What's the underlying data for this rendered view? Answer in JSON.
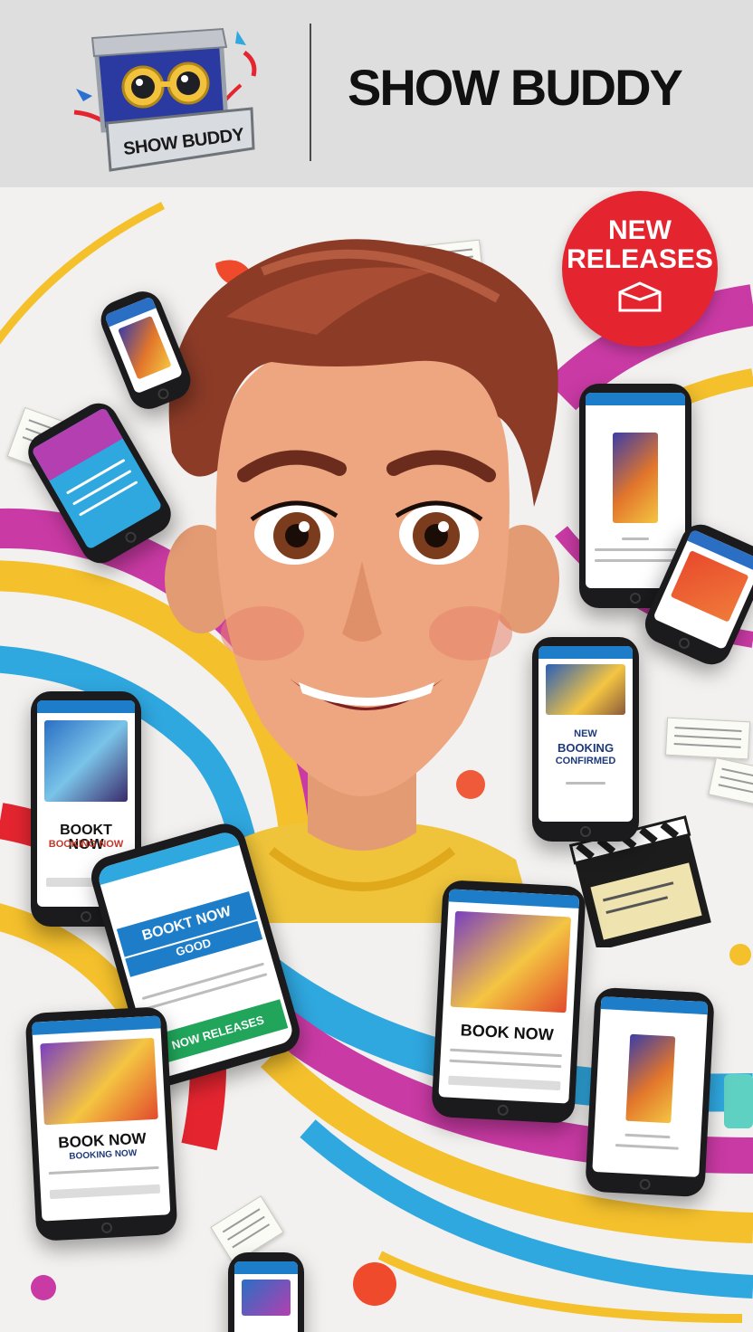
{
  "header": {
    "brand_title": "SHOW BUDDY",
    "logo_plate_text": "SHOW BUDDY"
  },
  "badge": {
    "line1": "NEW",
    "line2": "RELEASES",
    "icon": "box-icon"
  },
  "phones": {
    "left_middle": {
      "title": "BOOKT NOW",
      "subtitle": "BOOKING NOW"
    },
    "center_left": {
      "line1": "BOOKT NOW",
      "line2": "GOOD",
      "footer": "NOW RELEASES"
    },
    "right_middle": {
      "line1": "NEW",
      "line2": "BOOKING",
      "line3": "CONFIRMED"
    },
    "bottom_center": {
      "title": "BOOK NOW"
    },
    "bottom_left": {
      "title": "BOOK NOW",
      "subtitle": "BOOKING NOW"
    }
  },
  "colors": {
    "brand_red": "#e42530",
    "magenta": "#c93aa4",
    "yellow": "#f4c02c",
    "cyan": "#2fa7df",
    "blue": "#1e7dc8",
    "header_bg": "#dedede",
    "shirt_yellow": "#f0c43a"
  }
}
